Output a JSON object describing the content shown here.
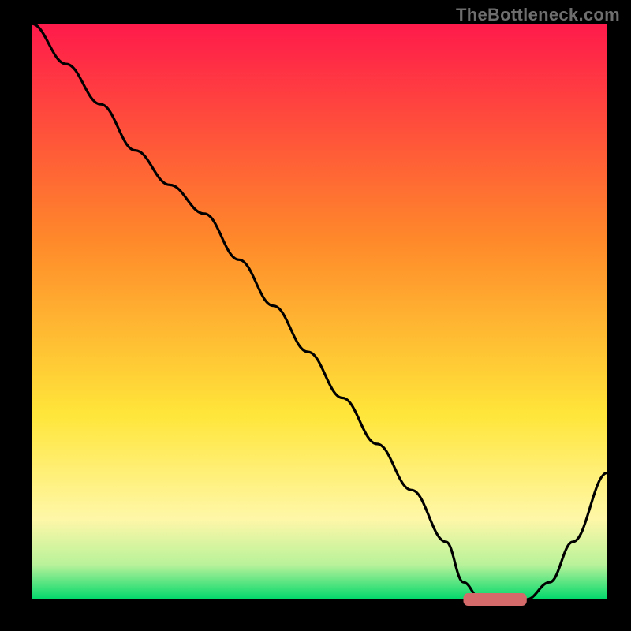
{
  "watermark": "TheBottleneck.com",
  "colors": {
    "top": "#ff1a4b",
    "orange": "#ff8a2a",
    "yellow": "#ffe63a",
    "paleYellow": "#fff7a8",
    "lightGreen": "#b8f29a",
    "green": "#00d86b",
    "curve": "#000000",
    "marker": "#d46a6a",
    "frame": "#000000"
  },
  "chart_data": {
    "type": "line",
    "title": "",
    "xlabel": "",
    "ylabel": "",
    "xlim": [
      0,
      100
    ],
    "ylim": [
      0,
      100
    ],
    "series": [
      {
        "name": "bottleneck-curve",
        "x": [
          0,
          6,
          12,
          18,
          24,
          30,
          36,
          42,
          48,
          54,
          60,
          66,
          72,
          75,
          78,
          82,
          86,
          90,
          94,
          100
        ],
        "y": [
          100,
          93,
          86,
          78,
          72,
          67,
          59,
          51,
          43,
          35,
          27,
          19,
          10,
          3,
          0,
          0,
          0,
          3,
          10,
          22
        ]
      }
    ],
    "marker": {
      "x_start": 75,
      "x_end": 86,
      "y": 0,
      "thickness_pct": 2.2
    }
  }
}
